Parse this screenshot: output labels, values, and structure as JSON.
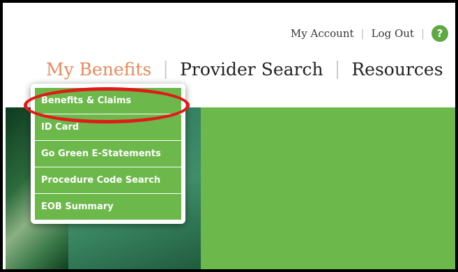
{
  "utility_nav": {
    "my_account": "My Account",
    "separator": "|",
    "log_out": "Log Out",
    "help": "?"
  },
  "main_nav": {
    "tabs": [
      {
        "label": "My Benefits",
        "active": true
      },
      {
        "label": "Provider Search",
        "active": false
      },
      {
        "label": "Resources",
        "active": false
      }
    ]
  },
  "dropdown": {
    "items": [
      {
        "label": "Benefits & Claims"
      },
      {
        "label": "ID Card"
      },
      {
        "label": "Go Green E-Statements"
      },
      {
        "label": "Procedure Code Search"
      },
      {
        "label": "EOB Summary"
      }
    ]
  },
  "colors": {
    "accent_green": "#6db84b",
    "active_tab": "#e8895a",
    "highlight_red": "#e01a1a"
  },
  "icons": {
    "help": "help-icon"
  }
}
